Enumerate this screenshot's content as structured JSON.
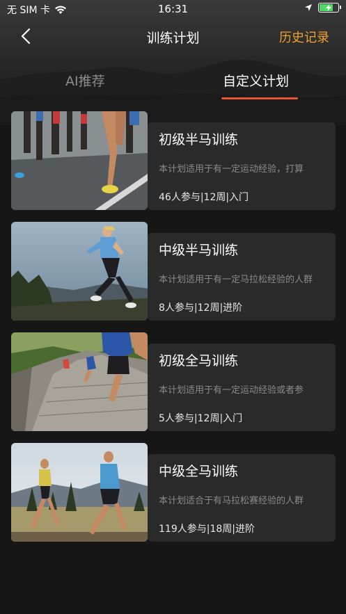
{
  "status_bar": {
    "carrier": "无 SIM 卡",
    "time": "16:31",
    "wifi_icon": "wifi-icon",
    "location_icon": "location-arrow-icon",
    "battery_icon": "battery-charging-icon",
    "battery_level": 0.75
  },
  "nav": {
    "back_icon": "chevron-left-icon",
    "title": "训练计划",
    "history_label": "历史记录",
    "history_color": "#f0a030"
  },
  "tabs": [
    {
      "label": "AI推荐",
      "active": false
    },
    {
      "label": "自定义计划",
      "active": true
    }
  ],
  "accent_color": "#e8552e",
  "plans": [
    {
      "title": "初级半马训练",
      "description": "本计划适用于有一定运动经验，打算",
      "meta": "46人参与|12周|入门",
      "image": "marathon-runners-road-photo"
    },
    {
      "title": "中级半马训练",
      "description": "本计划适用于有一定马拉松经验的人群",
      "meta": "8人参与|12周|进阶",
      "image": "woman-running-mountain-photo"
    },
    {
      "title": "初级全马训练",
      "description": "本计划适用于有一定运动经验或者参",
      "meta": "5人参与|12周|入门",
      "image": "great-wall-runners-photo"
    },
    {
      "title": "中级全马训练",
      "description": "本计划适合于有马拉松赛经验的人群",
      "meta": "119人参与|18周|进阶",
      "image": "couple-running-field-photo"
    }
  ]
}
